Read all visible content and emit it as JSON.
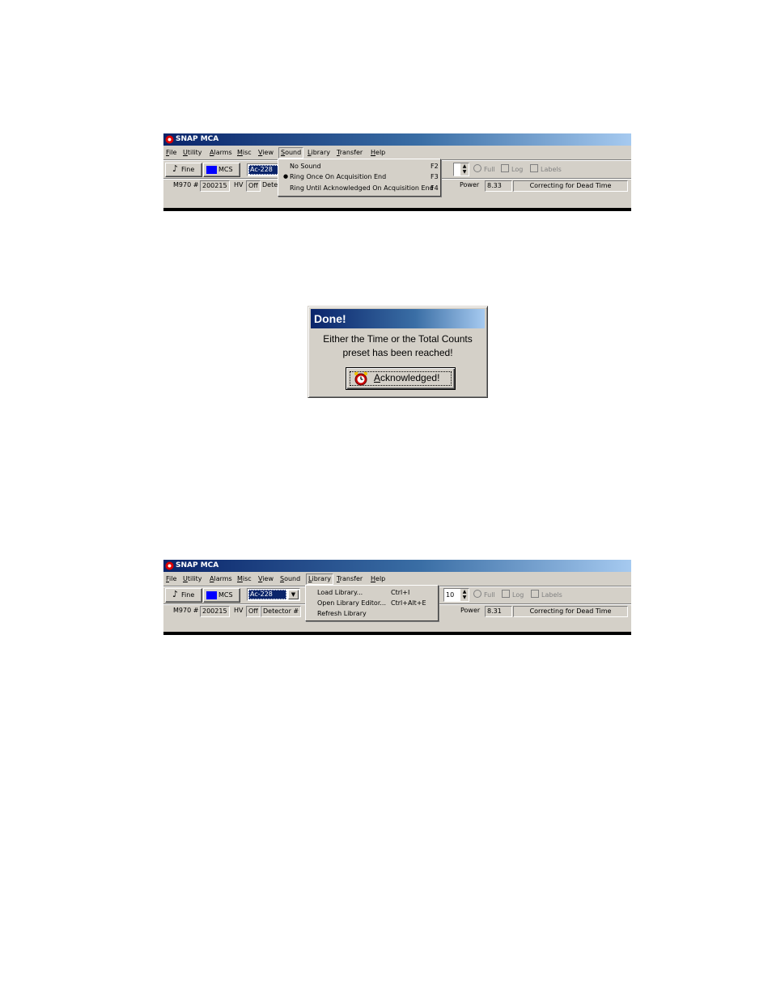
{
  "window1": {
    "title": "SNAP MCA",
    "menu": [
      {
        "hot": "F",
        "rest": "ile"
      },
      {
        "hot": "U",
        "rest": "tility"
      },
      {
        "hot": "A",
        "rest": "larms"
      },
      {
        "hot": "M",
        "rest": "isc"
      },
      {
        "hot": "V",
        "rest": "iew"
      },
      {
        "hot": "S",
        "rest": "ound"
      },
      {
        "hot": "L",
        "rest": "ibrary"
      },
      {
        "hot": "T",
        "rest": "ransfer"
      },
      {
        "hot": "H",
        "rest": "elp"
      }
    ],
    "toolbar": {
      "fine_label": "Fine",
      "mcs_label": "MCS",
      "isotope": "Ac-228",
      "full_label": "Full",
      "log_label": "Log",
      "labels_label": "Labels"
    },
    "status": {
      "m970_label": "M970 #",
      "serial": "200215",
      "hv_label": "HV",
      "hv_value": "Off",
      "detector_label": "Dete",
      "power_label": "Power",
      "power_value": "8.33",
      "dead_time": "Correcting for Dead Time"
    },
    "sound_menu": [
      {
        "label": "No Sound",
        "shortcut": "F2",
        "checked": false
      },
      {
        "label": "Ring Once On Acquisition End",
        "shortcut": "F3",
        "checked": true
      },
      {
        "label": "Ring Until Acknowledged On Acquisition End",
        "shortcut": "F4",
        "checked": false
      }
    ],
    "bullet": "●"
  },
  "dialog": {
    "title": "Done!",
    "line1": "Either the Time or the Total Counts",
    "line2": "preset has been reached!",
    "button_hot": "A",
    "button_rest": "cknowledged!"
  },
  "window2": {
    "title": "SNAP MCA",
    "toolbar": {
      "fine_label": "Fine",
      "mcs_label": "MCS",
      "isotope": "Ac-228",
      "spin_value": "10",
      "full_label": "Full",
      "log_label": "Log",
      "labels_label": "Labels"
    },
    "status": {
      "m970_label": "M970 #",
      "serial": "200215",
      "hv_label": "HV",
      "hv_value": "Off",
      "detector_label": "Detector #",
      "power_label": "Power",
      "power_value": "8.31",
      "dead_time": "Correcting for Dead Time"
    },
    "library_menu": [
      {
        "label": "Load Library...",
        "shortcut": "Ctrl+I"
      },
      {
        "label": "Open Library Editor...",
        "shortcut": "Ctrl+Alt+E"
      },
      {
        "label": "Refresh Library",
        "shortcut": ""
      }
    ]
  },
  "colors": {
    "title_dark": "#0a246a",
    "title_light": "#a6caf0",
    "face": "#d4d0c8",
    "mcs_swatch": "#0000ff"
  },
  "icons": [
    "app-icon",
    "music-note-icon",
    "alarm-clock-icon",
    "dropdown-arrow-icon",
    "spin-arrows-icon"
  ]
}
